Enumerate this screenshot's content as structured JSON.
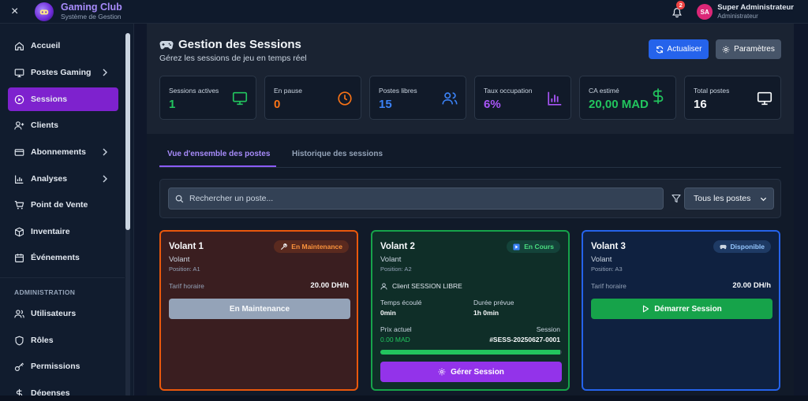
{
  "app": {
    "title": "Gaming Club",
    "subtitle": "Système de Gestion",
    "close_glyph": "×"
  },
  "topbar": {
    "notification_count": "2",
    "user_initials": "SA",
    "user_name": "Super Administrateur",
    "user_role": "Administrateur"
  },
  "sidebar": {
    "items": [
      {
        "label": "Accueil",
        "icon": "home-icon"
      },
      {
        "label": "Postes Gaming",
        "icon": "monitor-icon",
        "has_children": true
      },
      {
        "label": "Sessions",
        "icon": "play-circle-icon",
        "active": true
      },
      {
        "label": "Clients",
        "icon": "user-plus-icon"
      },
      {
        "label": "Abonnements",
        "icon": "card-icon",
        "has_children": true
      },
      {
        "label": "Analyses",
        "icon": "bar-chart-icon",
        "has_children": true
      },
      {
        "label": "Point de Vente",
        "icon": "cart-icon"
      },
      {
        "label": "Inventaire",
        "icon": "box-icon"
      },
      {
        "label": "Événements",
        "icon": "calendar-icon"
      }
    ],
    "section_label": "ADMINISTRATION",
    "admin_items": [
      {
        "label": "Utilisateurs",
        "icon": "users-icon"
      },
      {
        "label": "Rôles",
        "icon": "shield-icon"
      },
      {
        "label": "Permissions",
        "icon": "key-icon"
      },
      {
        "label": "Dépenses",
        "icon": "dollar-icon"
      }
    ]
  },
  "header": {
    "title": "Gestion des Sessions",
    "subtitle": "Gérez les sessions de jeu en temps réel",
    "refresh_label": "Actualiser",
    "settings_label": "Paramètres"
  },
  "stats": [
    {
      "label": "Sessions actives",
      "value": "1",
      "color": "#22c55e",
      "icon": "monitor-icon"
    },
    {
      "label": "En pause",
      "value": "0",
      "color": "#f97316",
      "icon": "clock-icon"
    },
    {
      "label": "Postes libres",
      "value": "15",
      "color": "#3b82f6",
      "icon": "users-icon"
    },
    {
      "label": "Taux occupation",
      "value": "6%",
      "color": "#a855f7",
      "icon": "bar-chart-icon"
    },
    {
      "label": "CA estimé",
      "value": "20,00 MAD",
      "color": "#22c55e",
      "icon": "dollar-icon"
    },
    {
      "label": "Total postes",
      "value": "16",
      "color": "#f8fafc",
      "icon": "monitor-icon"
    }
  ],
  "tabs": {
    "overview": "Vue d'ensemble des postes",
    "history": "Historique des sessions"
  },
  "filters": {
    "search_placeholder": "Rechercher un poste...",
    "select_value": "Tous les postes"
  },
  "cards": [
    {
      "name": "Volant 1",
      "type": "Volant",
      "position": "Position: A1",
      "status": "En Maintenance",
      "rate_label": "Tarif horaire",
      "rate_value": "20.00 DH/h",
      "action": "En Maintenance"
    },
    {
      "name": "Volant 2",
      "type": "Volant",
      "position": "Position: A2",
      "status": "En Cours",
      "client": "Client SESSION LIBRE",
      "elapsed_label": "Temps écoulé",
      "elapsed_value": "0min",
      "planned_label": "Durée prévue",
      "planned_value": "1h 0min",
      "price_label": "Prix actuel",
      "price_value": "0.00 MAD",
      "session_label": "Session",
      "session_value": "#SESS-20250627-0001",
      "progress": 0.99,
      "action": "Gérer Session"
    },
    {
      "name": "Volant 3",
      "type": "Volant",
      "position": "Position: A3",
      "status": "Disponible",
      "rate_label": "Tarif horaire",
      "rate_value": "20.00 DH/h",
      "action": "Démarrer Session"
    }
  ]
}
